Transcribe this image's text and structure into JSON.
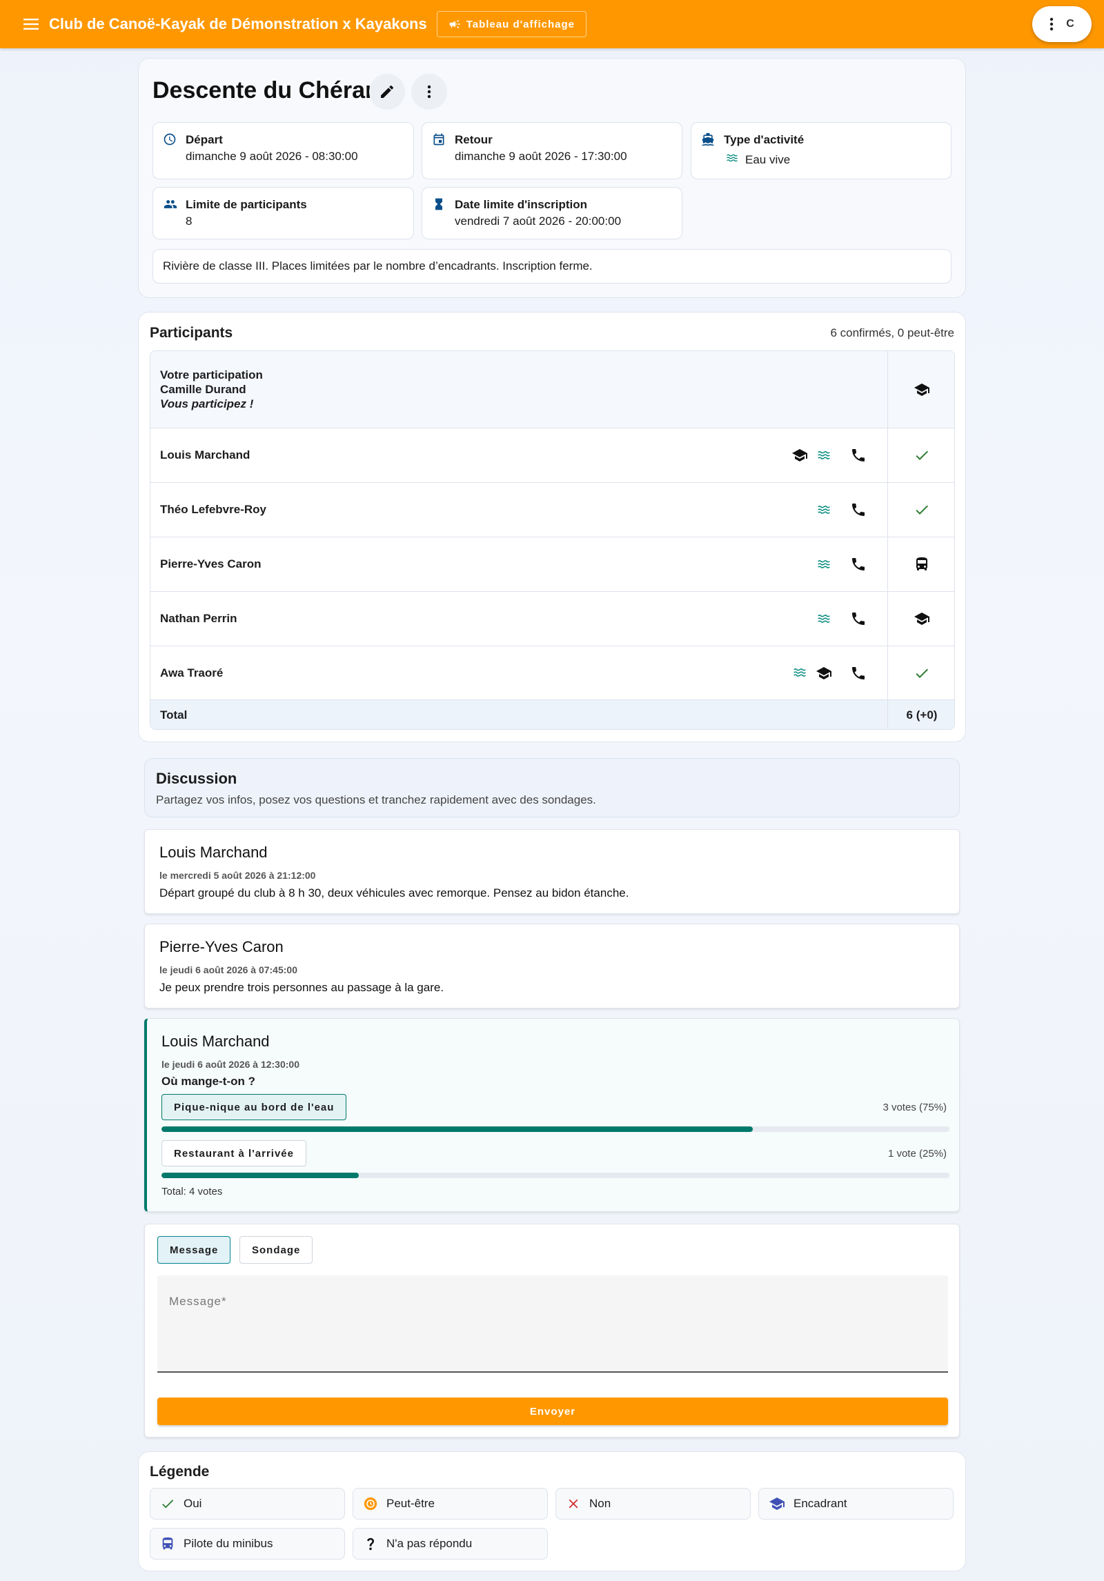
{
  "appbar": {
    "title": "Club de Canoë-Kayak de Démonstration x Kayakons",
    "board_label": "Tableau d'affichage",
    "user_initial": "C"
  },
  "event": {
    "title": "Descente du Chéran",
    "depart_label": "Départ",
    "depart_value": "dimanche 9 août 2026 - 08:30:00",
    "retour_label": "Retour",
    "retour_value": "dimanche 9 août 2026 - 17:30:00",
    "type_label": "Type d'activité",
    "type_value": "Eau vive",
    "limit_label": "Limite de participants",
    "limit_value": "8",
    "deadline_label": "Date limite d'inscription",
    "deadline_value": "vendredi 7 août 2026 - 20:00:00",
    "description": "Rivière de classe III. Places limitées par le nombre d’encadrants. Inscription ferme."
  },
  "participants": {
    "title": "Participants",
    "summary": "6 confirmés, 0 peut-être",
    "you_label": "Votre participation",
    "you_name": "Camille Durand",
    "you_status_text": "Vous participez !",
    "you_status": "encadrant",
    "rows": [
      {
        "name": "Louis Marchand",
        "icons": [
          "encadrant",
          "eau-vive",
          "phone"
        ],
        "status": "oui"
      },
      {
        "name": "Théo Lefebvre-Roy",
        "icons": [
          "eau-vive",
          "phone"
        ],
        "status": "oui"
      },
      {
        "name": "Pierre-Yves Caron",
        "icons": [
          "eau-vive",
          "phone"
        ],
        "status": "minibus"
      },
      {
        "name": "Nathan Perrin",
        "icons": [
          "eau-vive",
          "phone"
        ],
        "status": "encadrant"
      },
      {
        "name": "Awa Traoré",
        "icons": [
          "eau-vive",
          "encadrant",
          "phone"
        ],
        "status": "oui"
      }
    ],
    "total_label": "Total",
    "total_value": "6 (+0)"
  },
  "discussion": {
    "title": "Discussion",
    "subtitle": "Partagez vos infos, posez vos questions et tranchez rapidement avec des sondages.",
    "messages": [
      {
        "author": "Louis Marchand",
        "date": "le mercredi 5 août 2026 à 21:12:00",
        "body": "Départ groupé du club à 8 h 30, deux véhicules avec remorque. Pensez au bidon étanche."
      },
      {
        "author": "Pierre-Yves Caron",
        "date": "le jeudi 6 août 2026 à 07:45:00",
        "body": "Je peux prendre trois personnes au passage à la gare."
      }
    ],
    "poll": {
      "author": "Louis Marchand",
      "date": "le jeudi 6 août 2026 à 12:30:00",
      "question": "Où mange-t-on ?",
      "options": [
        {
          "label": "Pique-nique au bord de l'eau",
          "votes_text": "3 votes (75%)",
          "fraction": 0.75,
          "selected": true
        },
        {
          "label": "Restaurant à l'arrivée",
          "votes_text": "1 vote (25%)",
          "fraction": 0.25,
          "selected": false
        }
      ],
      "total": "Total: 4 votes"
    },
    "composer": {
      "tab_message": "Message",
      "tab_poll": "Sondage",
      "placeholder": "Message*",
      "send_label": "Envoyer"
    }
  },
  "legend": {
    "title": "Légende",
    "items": [
      {
        "label": "Oui",
        "icon": "check-icon"
      },
      {
        "label": "Peut-être",
        "icon": "maybe-icon"
      },
      {
        "label": "Non",
        "icon": "close-icon"
      },
      {
        "label": "Encadrant",
        "icon": "graduation-cap-icon"
      },
      {
        "label": "Pilote du minibus",
        "icon": "bus-icon"
      },
      {
        "label": "N'a pas répondu",
        "icon": "question-icon"
      }
    ]
  },
  "colors": {
    "primary": "#ff9800",
    "teal": "#00796b",
    "success": "#2e7d32",
    "error": "#d32f2f"
  }
}
